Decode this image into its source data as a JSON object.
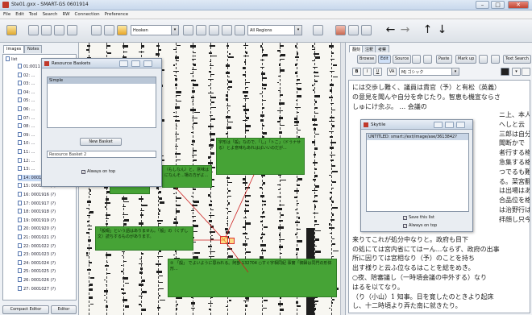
{
  "window": {
    "title": "Ste01.gxx - SMART-GS 0601914"
  },
  "menu": [
    "File",
    "Edit",
    "Tool",
    "Search",
    "RW",
    "Connection",
    "Preference"
  ],
  "toolbar": {
    "font_combo": "Hooken",
    "region_combo": "All Regions"
  },
  "left_panel": {
    "tabs": [
      "Images",
      "Notes"
    ],
    "tree_root": "list",
    "items": [
      "01:0011 ...",
      "02: ...",
      "03: ...",
      "04: ...",
      "05: ...",
      "06: ...",
      "07: ...",
      "08: ...",
      "09: ...",
      "10: ...",
      "11: ...",
      "12: ...",
      "13: ...",
      "14: 0001914 (?)",
      "15: 0001915 (?)",
      "16: 0001916 (?)",
      "17: 0001917 (?)",
      "18: 0001918 (?)",
      "19: 0001919 (?)",
      "20: 0001920 (?)",
      "21: 0001021 (?)",
      "22: 0001022 (?)",
      "23: 0001023 (?)",
      "24: 0001024 (?)",
      "25: 0001025 (?)",
      "26: 0001026 (?)",
      "27: 0001027 (?)"
    ],
    "selected_index": 13,
    "compact_editor": "Compact Editor",
    "editor": "Editor"
  },
  "basket": {
    "title": "Resource Baskets",
    "list_header": "Simple",
    "new_basket": "New Basket",
    "name_value": "Resource Basket 2",
    "always_on_top": "Always on top"
  },
  "annotations": [
    "字形は「般」なので、「し」「トこ」（ドうナせる）とよ意味もあれはばいいのだが...",
    "（もしなん）と。意味はになんそ...場の方がよ...",
    "写歸。 Lu",
    "「般暇」という語はありません。「般」の（くずし文）読ちするものがあります。",
    "② 「般」 でよいように思われる。阿部 132704 ○すぐ字相同紀 事實「御歸は同門の形体形..."
  ],
  "editor": {
    "tabs": [
      "翻刻",
      "注釈",
      "考察"
    ],
    "buttons": [
      "Browse",
      "Edit",
      "Source",
      "Paste",
      "Mark up",
      "Text Search"
    ],
    "font_value": "MJ ゴシック",
    "lines": [
      "には交歩し難く、議員は貴官（予）と有松（英義）",
      "の意見を聞んや自分を命じたり。智恵も機宣ならさ",
      "しゅにけ余ぶ。 ... 会議の",
      "",
      "",
      "",
      "",
      "",
      "",
      "",
      "",
      "",
      "",
      "",
      "",
      "",
      "来りてこれが処分中なりと。政府も目下",
      "の処にては宮内省にてはーん...ならず、政府の出事",
      "所に因りては宮相なり（予）のことを持ち",
      "出す様りと云ふ位なるはことを総をめき。",
      "○夜、陪審議し（一時頃会議の中外する）なり",
      "はるを以てなり。",
      "（り（小山）1 知事。日を寛したのときより起床",
      "し、十二時頃より弄た南に就きたり。"
    ],
    "side_right": [
      "ニ上、本人",
      "へしと云",
      "三郎は自分",
      "聞断かで",
      "者行する格",
      "急集する格",
      "つでるも難",
      "る。菜宮翻翻",
      "は出場はある",
      "合品位を格",
      "は治野行は",
      "拝顔し只今"
    ]
  },
  "keyword_dialog": {
    "title": "Skytile",
    "header": "UNTITLED: smart://ext/image/ase/3613842?",
    "save_list": "Save this list",
    "always_on_top": "Always on top"
  }
}
